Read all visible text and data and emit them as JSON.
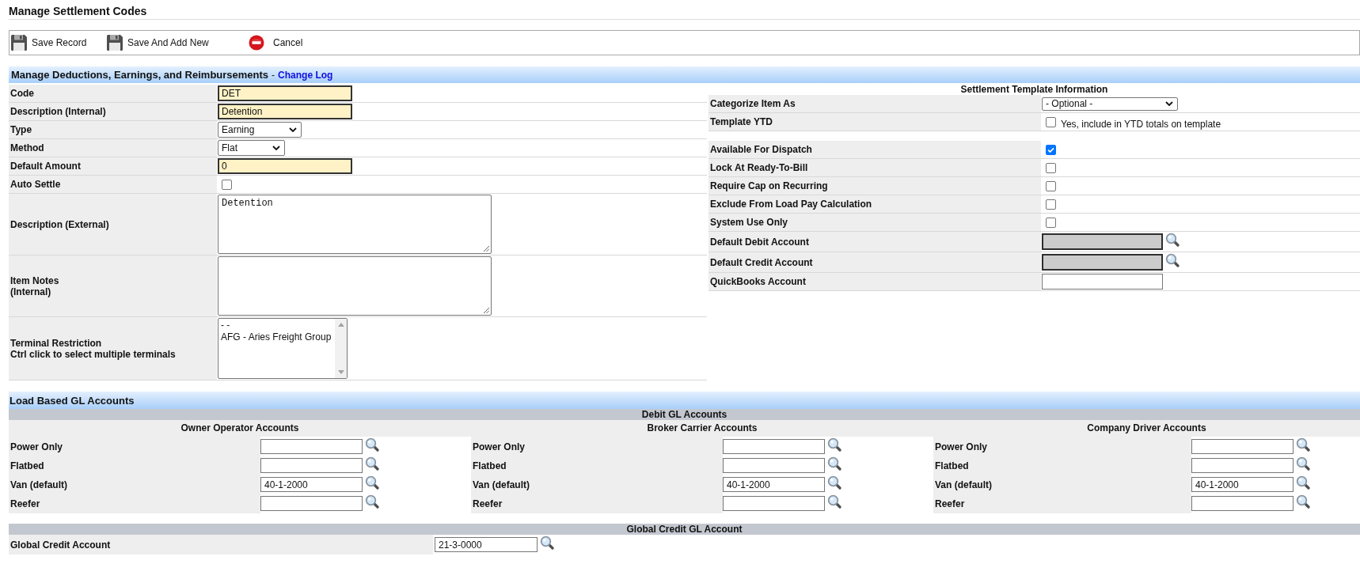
{
  "page_title": "Manage Settlement Codes",
  "toolbar": [
    {
      "kind": "save",
      "label": "Save Record"
    },
    {
      "kind": "save_new",
      "label": "Save And Add New"
    },
    {
      "kind": "cancel",
      "label": "Cancel"
    }
  ],
  "main_section": {
    "title": "Manage Deductions, Earnings, and Reimbursements",
    "separator": "-",
    "link": "Change Log"
  },
  "left_fields": [
    {
      "kind": "text",
      "label": "Code",
      "value": "DET",
      "required": true
    },
    {
      "kind": "text",
      "label": "Description (Internal)",
      "value": "Detention",
      "required": true
    },
    {
      "kind": "select",
      "label": "Type",
      "value": "Earning"
    },
    {
      "kind": "select",
      "label": "Method",
      "value": "Flat"
    },
    {
      "kind": "text",
      "label": "Default Amount",
      "value": "0",
      "required": true
    },
    {
      "kind": "checkbox",
      "label": "Auto Settle",
      "checked": false
    },
    {
      "kind": "textarea",
      "label": "Description (External)",
      "value": "Detention"
    },
    {
      "kind": "textarea",
      "label": "Item Notes\n(Internal)"
    },
    {
      "kind": "listbox",
      "label": "Terminal Restriction\nCtrl click to select multiple terminals",
      "options": [
        "- -",
        "AFG - Aries Freight Group"
      ]
    }
  ],
  "template": {
    "title": "Settlement Template Information",
    "rows": [
      {
        "kind": "select",
        "label": "Categorize Item As",
        "value": "- Optional -"
      },
      {
        "kind": "checkbox",
        "label": "Template YTD",
        "checked": false,
        "note": "Yes, include in YTD totals on template"
      }
    ]
  },
  "options": [
    {
      "kind": "checkbox",
      "label": "Available For Dispatch",
      "checked": true
    },
    {
      "kind": "checkbox",
      "label": "Lock At Ready-To-Bill",
      "checked": false
    },
    {
      "kind": "checkbox",
      "label": "Require Cap on Recurring",
      "checked": false
    },
    {
      "kind": "checkbox",
      "label": "Exclude From Load Pay Calculation",
      "checked": false
    },
    {
      "kind": "checkbox",
      "label": "System Use Only",
      "checked": false
    },
    {
      "kind": "lookup",
      "label": "Default Debit Account",
      "disabled": true
    },
    {
      "kind": "lookup",
      "label": "Default Credit Account",
      "disabled": true
    },
    {
      "kind": "text",
      "label": "QuickBooks Account",
      "required": false
    }
  ],
  "gl_section": {
    "title": "Load Based GL Accounts",
    "debit_title": "Debit GL Accounts",
    "groups": [
      {
        "title": "Owner Operator Accounts",
        "rows": [
          {
            "label": "Power Only"
          },
          {
            "label": "Flatbed"
          },
          {
            "label": "Van (default)",
            "value": "40-1-2000"
          },
          {
            "label": "Reefer"
          }
        ]
      },
      {
        "title": "Broker Carrier Accounts",
        "rows": [
          {
            "label": "Power Only"
          },
          {
            "label": "Flatbed"
          },
          {
            "label": "Van (default)",
            "value": "40-1-2000"
          },
          {
            "label": "Reefer"
          }
        ]
      },
      {
        "title": "Company Driver Accounts",
        "rows": [
          {
            "label": "Power Only"
          },
          {
            "label": "Flatbed"
          },
          {
            "label": "Van (default)",
            "value": "40-1-2000"
          },
          {
            "label": "Reefer"
          }
        ]
      }
    ],
    "credit_title": "Global Credit GL Account",
    "credit_rows": [
      {
        "label": "Global Credit Account",
        "value": "21-3-0000"
      }
    ]
  }
}
